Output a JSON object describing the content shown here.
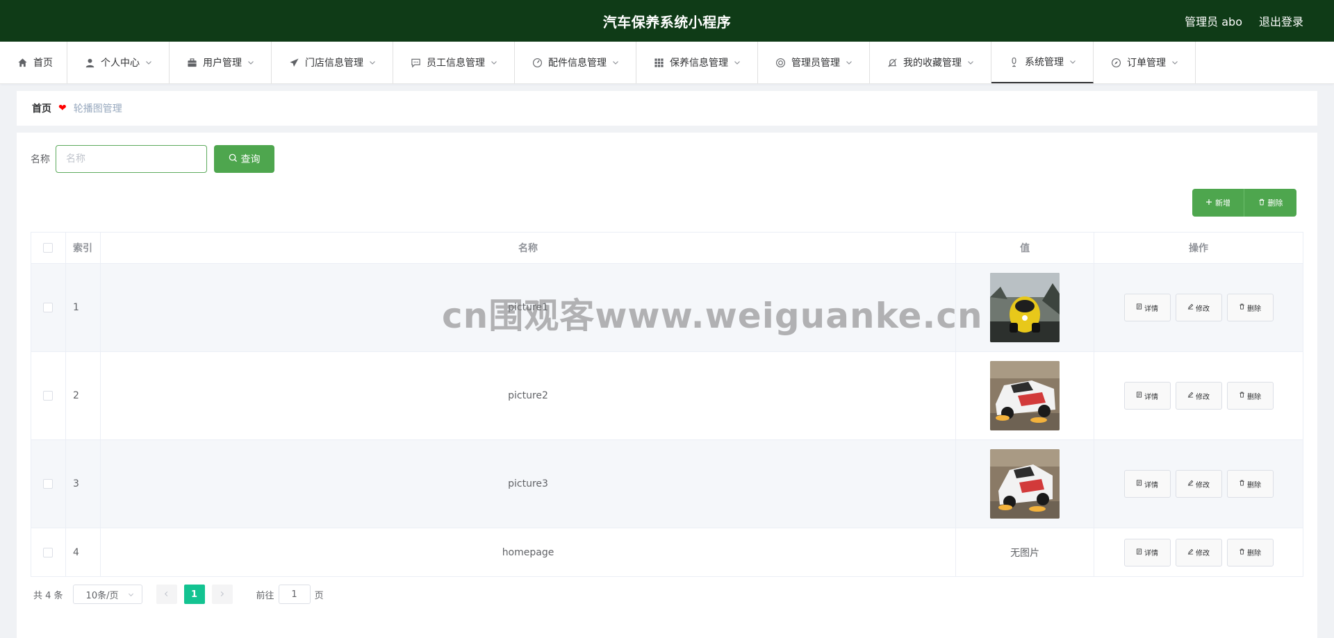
{
  "header": {
    "title": "汽车保养系统小程序",
    "user": "管理员 abo",
    "logout": "退出登录"
  },
  "nav": [
    {
      "label": "首页",
      "icon": "home-icon",
      "dropdown": false
    },
    {
      "label": "个人中心",
      "icon": "user-icon",
      "dropdown": true
    },
    {
      "label": "用户管理",
      "icon": "briefcase-icon",
      "dropdown": true
    },
    {
      "label": "门店信息管理",
      "icon": "send-icon",
      "dropdown": true
    },
    {
      "label": "员工信息管理",
      "icon": "chat-icon",
      "dropdown": true
    },
    {
      "label": "配件信息管理",
      "icon": "gauge-icon",
      "dropdown": true
    },
    {
      "label": "保养信息管理",
      "icon": "grid-icon",
      "dropdown": true
    },
    {
      "label": "管理员管理",
      "icon": "lifebuoy-icon",
      "dropdown": true
    },
    {
      "label": "我的收藏管理",
      "icon": "bell-off-icon",
      "dropdown": true
    },
    {
      "label": "系统管理",
      "icon": "microphone-icon",
      "dropdown": true,
      "active": true
    },
    {
      "label": "订单管理",
      "icon": "compass-icon",
      "dropdown": true
    }
  ],
  "breadcrumb": {
    "home": "首页",
    "current": "轮播图管理"
  },
  "search": {
    "label": "名称",
    "placeholder": "名称",
    "button": "查询"
  },
  "actions": {
    "add": "新增",
    "delete": "删除"
  },
  "table": {
    "columns": [
      "索引",
      "名称",
      "值",
      "操作"
    ],
    "rows": [
      {
        "index": "1",
        "name": "picture1",
        "value": "image",
        "image": "yellow-race-car"
      },
      {
        "index": "2",
        "name": "picture2",
        "value": "image",
        "image": "white-race-car"
      },
      {
        "index": "3",
        "name": "picture3",
        "value": "image",
        "image": "white-race-car"
      },
      {
        "index": "4",
        "name": "homepage",
        "value": "无图片",
        "image": ""
      }
    ],
    "row_actions": {
      "detail": "详情",
      "edit": "修改",
      "delete": "删除"
    }
  },
  "pagination": {
    "total": "共 4 条",
    "page_size": "10条/页",
    "current_page": "1",
    "goto_prefix": "前往",
    "goto_value": "1",
    "goto_suffix": "页"
  },
  "watermark": "cn围观客www.weiguanke.cn",
  "colors": {
    "header_bg": "#0f3b17",
    "primary": "#4ea64e",
    "page_active": "#13c391"
  }
}
